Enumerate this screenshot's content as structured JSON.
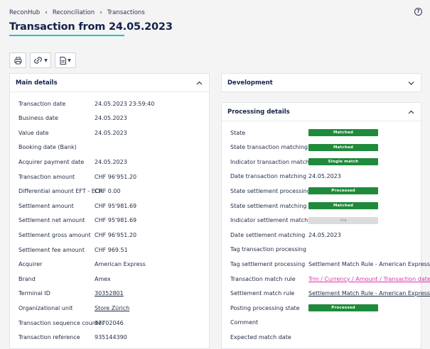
{
  "breadcrumb": [
    "ReconHub",
    "Reconciliation",
    "Transactions"
  ],
  "page_title": "Transaction from 24.05.2023",
  "main_details": {
    "title": "Main details",
    "rows": [
      {
        "label": "Transaction date",
        "value": "24.05.2023 23:59:40",
        "style": "plain"
      },
      {
        "label": "Business date",
        "value": "24.05.2023",
        "style": "plain"
      },
      {
        "label": "Value date",
        "value": "24.05.2023",
        "style": "plain"
      },
      {
        "label": "Booking date (Bank)",
        "value": "",
        "style": "plain"
      },
      {
        "label": "Acquirer payment date",
        "value": "24.05.2023",
        "style": "plain"
      },
      {
        "label": "Transaction amount",
        "value": "CHF 96'951.20",
        "style": "plain"
      },
      {
        "label": "Differential amount EFT - ECR",
        "value": "CHF 0.00",
        "style": "plain"
      },
      {
        "label": "Settlement amount",
        "value": "CHF 95'981.69",
        "style": "plain"
      },
      {
        "label": "Settlement net amount",
        "value": "CHF 95'981.69",
        "style": "plain"
      },
      {
        "label": "Settlement gross amount",
        "value": "CHF 96'951.20",
        "style": "plain"
      },
      {
        "label": "Settlement fee amount",
        "value": "CHF 969.51",
        "style": "plain"
      },
      {
        "label": "Acquirer",
        "value": "American Express",
        "style": "plain"
      },
      {
        "label": "Brand",
        "value": "Amex",
        "style": "plain"
      },
      {
        "label": "Terminal ID",
        "value": "30352801",
        "style": "link"
      },
      {
        "label": "Organizational unit",
        "value": "Store Zürich",
        "style": "link"
      },
      {
        "label": "Transaction sequence counter",
        "value": "97702046",
        "style": "plain"
      },
      {
        "label": "Transaction reference",
        "value": "935144390",
        "style": "plain"
      }
    ]
  },
  "development": {
    "title": "Development"
  },
  "processing_details": {
    "title": "Processing details",
    "rows": [
      {
        "label": "State",
        "value": "Matched",
        "style": "badge-green"
      },
      {
        "label": "State transaction matching",
        "value": "Matched",
        "style": "badge-green"
      },
      {
        "label": "Indicator transaction matching",
        "value": "Single match",
        "style": "badge-green"
      },
      {
        "label": "Date transaction matching",
        "value": "24.05.2023",
        "style": "plain"
      },
      {
        "label": "State settlement processing",
        "value": "Processed",
        "style": "badge-green"
      },
      {
        "label": "State settlement matching",
        "value": "Matched",
        "style": "badge-green"
      },
      {
        "label": "Indicator settlement matching",
        "value": "n/a",
        "style": "badge-grey"
      },
      {
        "label": "Date settlement matching",
        "value": "24.05.2023",
        "style": "plain"
      },
      {
        "label": "Tag transaction processing",
        "value": "",
        "style": "plain"
      },
      {
        "label": "Tag settlement processing",
        "value": "Settlement Match Rule - American Express",
        "style": "plain"
      },
      {
        "label": "Transaction match rule",
        "value": "Trm / Currency / Amount / Transaction date",
        "style": "pinklink"
      },
      {
        "label": "Settlement match rule",
        "value": "Settlement Match Rule - American Express",
        "style": "link"
      },
      {
        "label": "Posting processing state",
        "value": "Processed",
        "style": "badge-green"
      },
      {
        "label": "Comment",
        "value": "",
        "style": "plain"
      },
      {
        "label": "Expected match date",
        "value": "",
        "style": "plain"
      }
    ]
  },
  "colors": {
    "accent_underline": "#19c4d4",
    "badge_green": "#1f8a3b",
    "badge_grey": "#dcdcdc",
    "link_pink": "#d63aa7"
  },
  "icons": [
    "help-icon",
    "print-icon",
    "link-icon",
    "document-icon",
    "chevron-up-icon",
    "chevron-down-icon",
    "chevron-right-icon"
  ]
}
